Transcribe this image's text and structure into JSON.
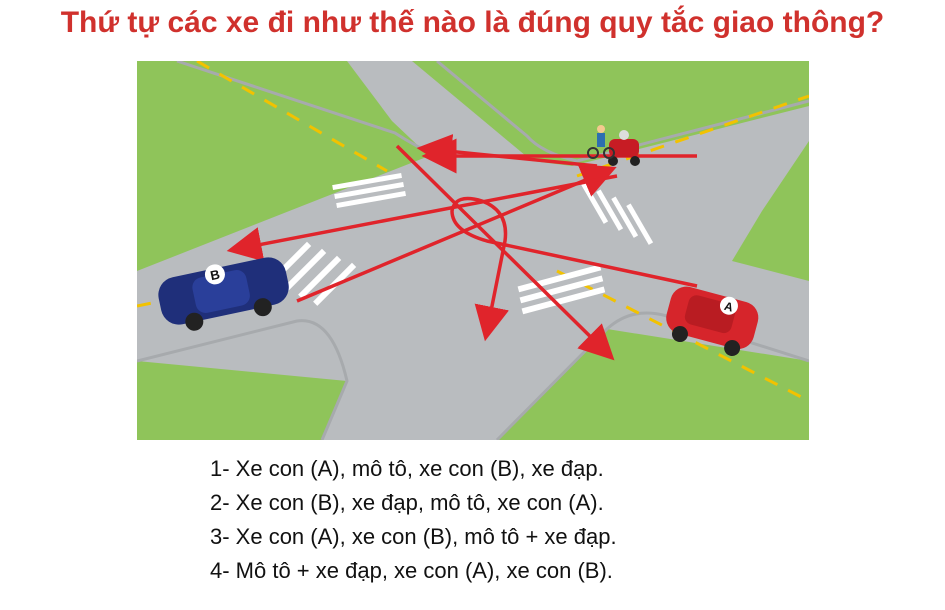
{
  "question": "Thứ tự các xe đi như thế nào là đúng quy tắc giao thông?",
  "scene": {
    "labels": {
      "car_a": "A",
      "car_b": "B"
    },
    "colors": {
      "title": "#d0312d",
      "grass": "#8fc45a",
      "road": "#b9bcbf",
      "arrow": "#e0242b",
      "car_a": "#d6252b",
      "car_b": "#1f2f7a",
      "lane_line": "#f2c200"
    },
    "vehicles": [
      "car-a",
      "car-b",
      "motorbike",
      "bicycle"
    ]
  },
  "answers": [
    "1- Xe con (A), mô tô, xe con (B), xe đạp.",
    "2- Xe con (B), xe đạp, mô tô, xe con (A).",
    "3- Xe con (A), xe con (B), mô tô + xe đạp.",
    "4- Mô tô + xe đạp, xe con (A), xe con (B)."
  ]
}
